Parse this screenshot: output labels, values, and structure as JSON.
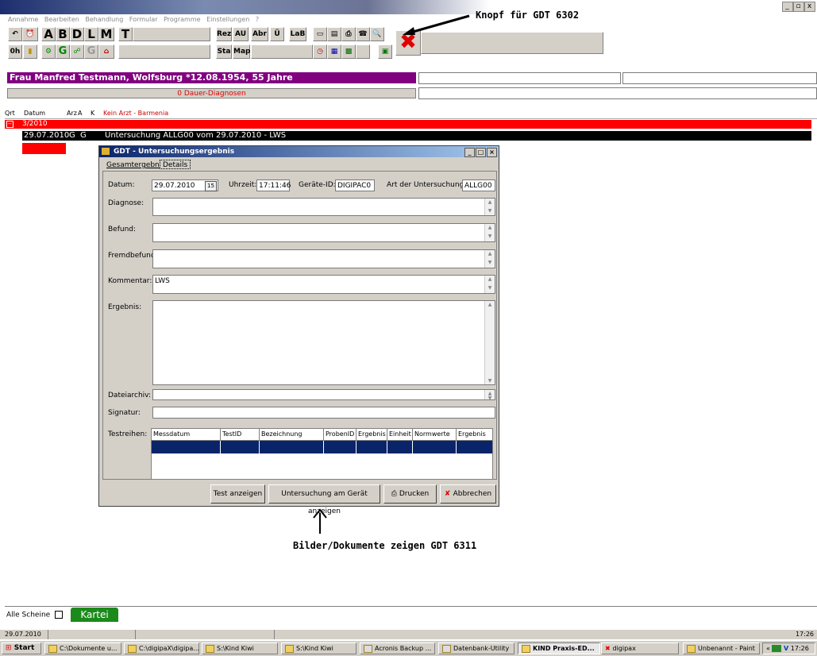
{
  "window": {
    "min": "_",
    "max": "▫",
    "close": "x"
  },
  "menu": [
    "Annahme",
    "Bearbeiten",
    "Behandlung",
    "Formular",
    "Programme",
    "Einstellungen",
    "?"
  ],
  "toolbar": {
    "row1": [
      "A",
      "B",
      "D",
      "L",
      "M",
      "T"
    ],
    "row1_mid": [
      "Rez",
      "AU",
      "Abr",
      "Ü",
      "LaB"
    ],
    "row2_left": "0h",
    "row2_mid": [
      "Sta",
      "Map"
    ]
  },
  "annotations": {
    "top": "Knopf für GDT 6302",
    "bottom": "Bilder/Dokumente zeigen GDT 6311"
  },
  "patient": {
    "header": "Frau  Manfred  Testmann,  Wolfsburg *12.08.1954, 55 Jahre",
    "dauer": "0 Dauer-Diagnosen"
  },
  "columns": [
    "Qrt",
    "Datum",
    "Arz",
    "A",
    "K",
    "Kein Arzt - Barmenia"
  ],
  "rows": {
    "quarter": "3/2010",
    "entry_date": "29.07.2010",
    "entry_g1": "G",
    "entry_g2": "G",
    "entry_text": "Untersuchung ALLG00 vom 29.07.2010 - LWS"
  },
  "dialog": {
    "title": "GDT - Untersuchungsergebnis",
    "tabs": [
      "Gesamtergebnis",
      "Details"
    ],
    "labels": {
      "datum": "Datum:",
      "uhrzeit": "Uhrzeit:",
      "geraete": "Geräte-ID:",
      "art": "Art der Untersuchung:",
      "diagnose": "Diagnose:",
      "befund": "Befund:",
      "fremdbefund": "Fremdbefund:",
      "kommentar": "Kommentar:",
      "ergebnis": "Ergebnis:",
      "dateiarchiv": "Dateiarchiv:",
      "signatur": "Signatur:",
      "testreihen": "Testreihen:"
    },
    "values": {
      "datum": "29.07.2010",
      "uhrzeit": "17:11:46",
      "geraete": "DIGIPAC0",
      "art": "ALLG00",
      "kommentar": "LWS",
      "date_btn": "15"
    },
    "grid_columns": [
      "Messdatum",
      "TestID",
      "Bezeichnung",
      "ProbenID",
      "Ergebnis",
      "Einheit",
      "Normwerte",
      "Ergebnis"
    ],
    "buttons": {
      "test": "Test anzeigen",
      "untersuchung": "Untersuchung am Gerät anzeigen",
      "drucken": "Drucken",
      "abbrechen": "Abbrechen"
    }
  },
  "bottom": {
    "alle_scheine": "Alle Scheine",
    "kartei": "Kartei",
    "status_date": "29.07.2010",
    "status_time": "17:26"
  },
  "taskbar": {
    "start": "Start",
    "tasks": [
      "C:\\Dokumente u...",
      "C:\\digipaX\\digipa...",
      "S:\\Kind Kiwi",
      "S:\\Kind Kiwi",
      "Acronis Backup ...",
      "Datenbank-Utility",
      "KIND Praxis-ED...",
      "digipax",
      "Unbenannt - Paint"
    ],
    "tray_time": "17:26",
    "tray_label": "«",
    "tray_v": "V"
  }
}
